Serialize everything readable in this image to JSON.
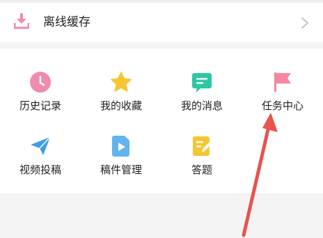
{
  "offline_cache": {
    "label": "离线缓存",
    "icon": "download-icon"
  },
  "grid": {
    "items": [
      {
        "label": "历史记录",
        "icon": "clock-icon",
        "color": "#f08bb0"
      },
      {
        "label": "我的收藏",
        "icon": "star-icon",
        "color": "#f7c531"
      },
      {
        "label": "我的消息",
        "icon": "message-icon",
        "color": "#2ec7a4"
      },
      {
        "label": "任务中心",
        "icon": "flag-icon",
        "color": "#f6879e"
      },
      {
        "label": "视频投稿",
        "icon": "paper-plane-icon",
        "color": "#3d9ee8"
      },
      {
        "label": "稿件管理",
        "icon": "video-file-icon",
        "color": "#62b4ef"
      },
      {
        "label": "答题",
        "icon": "edit-icon",
        "color": "#f7c531"
      }
    ]
  },
  "colors": {
    "accent_pink": "#f08bb0",
    "annotation_red": "#e9524f"
  }
}
